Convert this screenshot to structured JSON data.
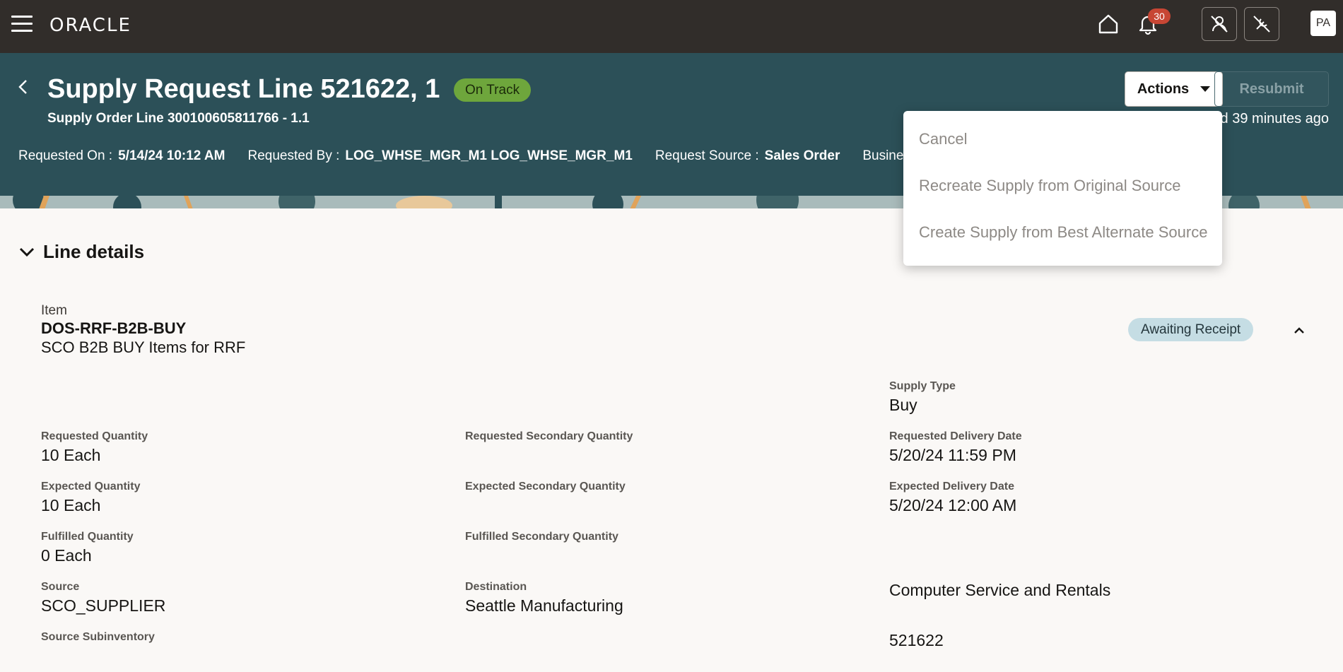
{
  "topbar": {
    "brand": "ORACLE",
    "notification_count": "30",
    "avatar_initials": "PA"
  },
  "header": {
    "title": "Supply Request Line 521622, 1",
    "status": "On Track",
    "subtitle": "Supply Order Line 300100605811766 - 1.1",
    "updated": "ed 39 minutes ago",
    "actions_label": "Actions",
    "resubmit_label": "Resubmit",
    "meta": {
      "requested_on_label": "Requested On :",
      "requested_on": "5/14/24 10:12 AM",
      "requested_by_label": "Requested By :",
      "requested_by": "LOG_WHSE_MGR_M1 LOG_WHSE_MGR_M1",
      "request_source_label": "Request Source :",
      "request_source": "Sales Order",
      "business_label": "Business"
    }
  },
  "actions_menu": {
    "items": [
      "Cancel",
      "Recreate Supply from Original Source",
      "Create Supply from Best Alternate Source"
    ]
  },
  "section": {
    "title": "Line details"
  },
  "item": {
    "label": "Item",
    "code": "DOS-RRF-B2B-BUY",
    "description": "SCO B2B BUY Items for RRF",
    "status": "Awaiting Receipt"
  },
  "fields": {
    "supply_type": {
      "label": "Supply Type",
      "value": "Buy"
    },
    "requested_quantity": {
      "label": "Requested Quantity",
      "value": "10 Each"
    },
    "requested_secondary_quantity": {
      "label": "Requested Secondary Quantity",
      "value": ""
    },
    "requested_delivery_date": {
      "label": "Requested Delivery Date",
      "value": "5/20/24 11:59 PM"
    },
    "expected_quantity": {
      "label": "Expected Quantity",
      "value": "10 Each"
    },
    "expected_secondary_quantity": {
      "label": "Expected Secondary Quantity",
      "value": ""
    },
    "expected_delivery_date": {
      "label": "Expected Delivery Date",
      "value": "5/20/24 12:00 AM"
    },
    "fulfilled_quantity": {
      "label": "Fulfilled Quantity",
      "value": "0 Each"
    },
    "fulfilled_secondary_quantity": {
      "label": "Fulfilled Secondary Quantity",
      "value": ""
    },
    "source": {
      "label": "Source",
      "value": "SCO_SUPPLIER"
    },
    "destination": {
      "label": "Destination",
      "value": "Seattle Manufacturing"
    },
    "source_subinventory": {
      "label": "Source Subinventory",
      "value": ""
    },
    "business_unit_value": "Computer Service and Rentals",
    "order_number_value": "521622"
  }
}
